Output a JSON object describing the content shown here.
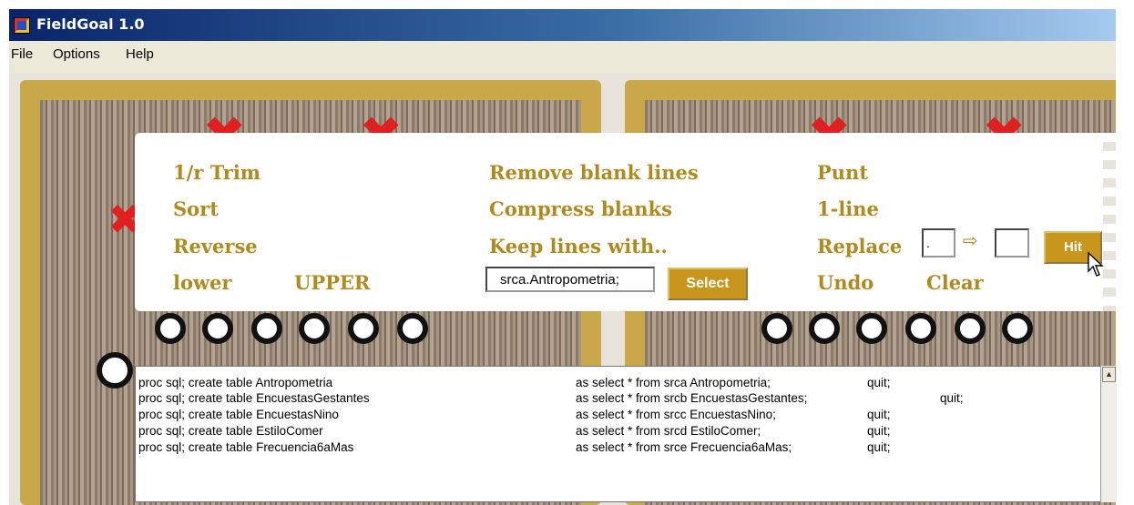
{
  "window": {
    "title": "FieldGoal 1.0",
    "icon": "app-icon"
  },
  "menu": {
    "items": [
      "File",
      "Options",
      "Help"
    ]
  },
  "commands": {
    "trim": "1/r Trim",
    "sort": "Sort",
    "reverse": "Reverse",
    "lower": "lower",
    "upper": "UPPER",
    "remove_blank": "Remove blank lines",
    "compress": "Compress blanks",
    "keep": "Keep  lines with..",
    "select_label": "Select",
    "punt": "Punt",
    "one_line": "1-line",
    "replace": "Replace",
    "undo": "Undo",
    "clear": "Clear",
    "hit_label": "Hit"
  },
  "inputs": {
    "keep_value": "srca.Antropometria;",
    "replace_from": ".",
    "replace_to": "",
    "arrow_icon": "arrow-right-icon"
  },
  "output_lines": [
    {
      "left": "proc sql; create table Antropometria",
      "mid": "as select * from srca Antropometria;",
      "right": "quit;"
    },
    {
      "left": "proc sql; create table EncuestasGestantes",
      "mid": "as select * from srcb EncuestasGestantes;",
      "right": "quit;"
    },
    {
      "left": "proc sql; create table EncuestasNino",
      "mid": "as select * from srcc EncuestasNino;",
      "right": "quit;"
    },
    {
      "left": "proc sql; create table EstiloComer",
      "mid": "as select * from srcd EstiloComer;",
      "right": "quit;"
    },
    {
      "left": "proc sql; create table Frecuencia6aMas",
      "mid": "as select * from srce Frecuencia6aMas;",
      "right": "quit;"
    }
  ],
  "colors": {
    "command_gold": "#b08a1c",
    "button_gold": "#c8961c",
    "x_red": "#e02020"
  }
}
